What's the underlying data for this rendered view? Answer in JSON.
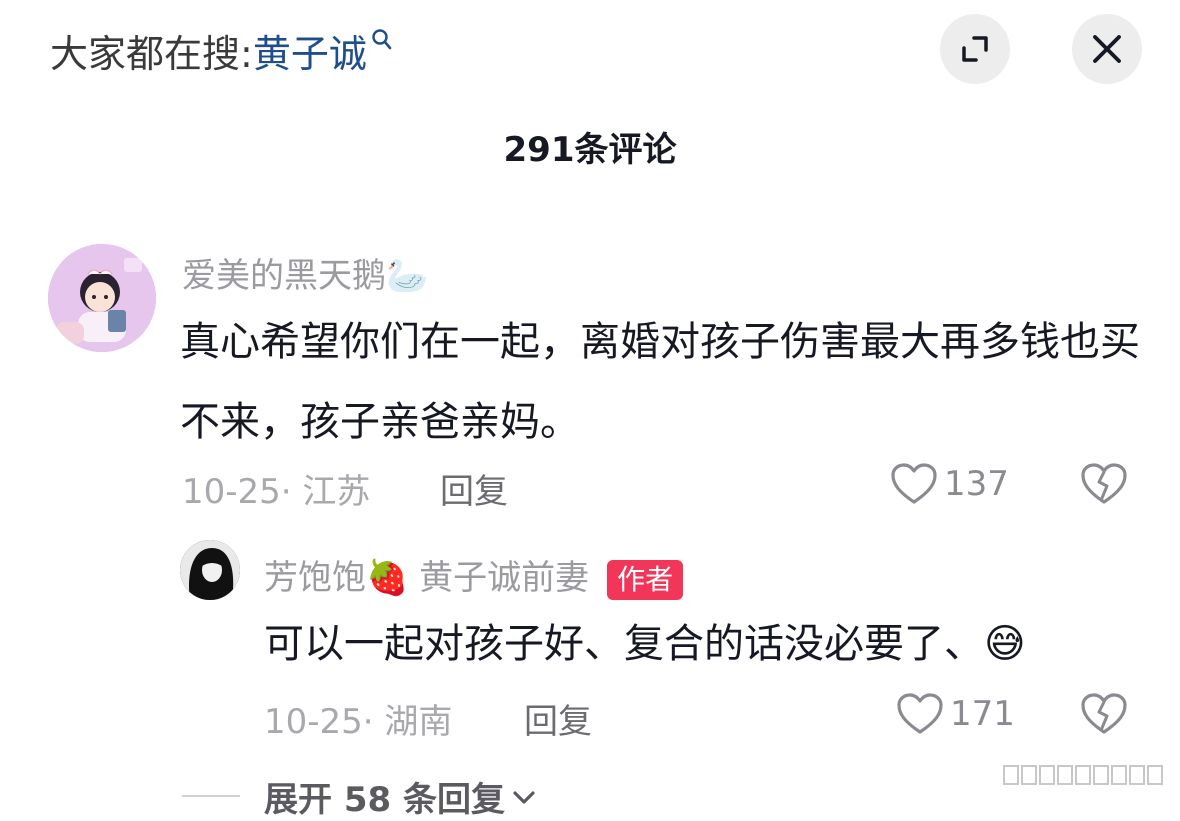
{
  "search": {
    "prefix": "大家都在搜:",
    "term": "黄子诚"
  },
  "comment_count": "291条评论",
  "comments": [
    {
      "username": "爱美的黑天鹅🦢",
      "text": "真心希望你们在一起，离婚对孩子伤害最大再多钱也买不来，孩子亲爸亲妈。",
      "meta": "10-25· 江苏",
      "reply_label": "回复",
      "likes": "137"
    }
  ],
  "reply": {
    "username": "芳饱饱🍓 黄子诚前妻",
    "badge": "作者",
    "text": "可以一起对孩子好、复合的话没必要了、😅",
    "meta": "10-25· 湖南",
    "reply_label": "回复",
    "likes": "171"
  },
  "expand_label": "展开 58 条回复",
  "colors": {
    "accent_link": "#1f4e8c",
    "author_badge": "#f2365a"
  },
  "icons": [
    "search-icon",
    "expand-icon",
    "close-icon",
    "heart-icon",
    "broken-heart-icon",
    "chevron-down-icon"
  ]
}
